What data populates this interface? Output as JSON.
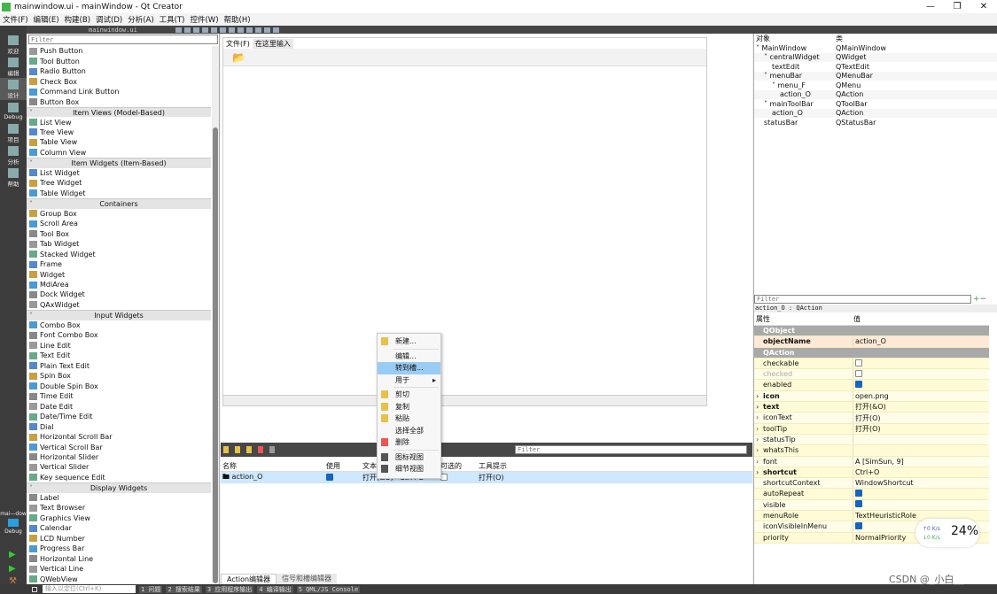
{
  "window": {
    "title": "mainwindow.ui - mainWindow - Qt Creator",
    "controls": [
      "—",
      "❐",
      "✕"
    ]
  },
  "menubar": [
    "文件(F)",
    "编辑(E)",
    "构建(B)",
    "调试(D)",
    "分析(A)",
    "工具(T)",
    "控件(W)",
    "帮助(H)"
  ],
  "editor_tab": "mainwindow.ui",
  "modes": [
    "欢迎",
    "编辑",
    "设计",
    "Debug",
    "项目",
    "分析",
    "帮助"
  ],
  "kit": {
    "name": "mai—dow",
    "mode": "Debug"
  },
  "widgetbox": {
    "filter_placeholder": "Filter",
    "sections": [
      {
        "title": "",
        "items": [
          "Push Button",
          "Tool Button",
          "Radio Button",
          "Check Box",
          "Command Link Button",
          "Button Box"
        ]
      },
      {
        "title": "Item Views (Model-Based)",
        "items": [
          "List View",
          "Tree View",
          "Table View",
          "Column View"
        ]
      },
      {
        "title": "Item Widgets (Item-Based)",
        "items": [
          "List Widget",
          "Tree Widget",
          "Table Widget"
        ]
      },
      {
        "title": "Containers",
        "items": [
          "Group Box",
          "Scroll Area",
          "Tool Box",
          "Tab Widget",
          "Stacked Widget",
          "Frame",
          "Widget",
          "MdiArea",
          "Dock Widget",
          "QAxWidget"
        ]
      },
      {
        "title": "Input Widgets",
        "items": [
          "Combo Box",
          "Font Combo Box",
          "Line Edit",
          "Text Edit",
          "Plain Text Edit",
          "Spin Box",
          "Double Spin Box",
          "Time Edit",
          "Date Edit",
          "Date/Time Edit",
          "Dial",
          "Horizontal Scroll Bar",
          "Vertical Scroll Bar",
          "Horizontal Slider",
          "Vertical Slider",
          "Key sequence Edit"
        ]
      },
      {
        "title": "Display Widgets",
        "items": [
          "Label",
          "Text Browser",
          "Graphics View",
          "Calendar",
          "LCD Number",
          "Progress Bar",
          "Horizontal Line",
          "Vertical Line",
          "QWebView"
        ]
      }
    ]
  },
  "form": {
    "menu": "文件(F)",
    "menu_placeholder": "在这里输入"
  },
  "action_editor": {
    "filter_placeholder": "Filter",
    "headers": [
      "名称",
      "使用",
      "文本",
      "快捷键",
      "可选的",
      "工具提示"
    ],
    "rows": [
      {
        "name": "action_O",
        "used": true,
        "text": "打开(&O)",
        "shortcut": "Ctrl+O",
        "checkable": false,
        "tooltip": "打开(O)"
      }
    ],
    "tabs": [
      "Action编辑器",
      "信号和槽编辑器"
    ]
  },
  "context_menu": [
    {
      "label": "新建...",
      "icon": "new-icon"
    },
    {
      "sep": true
    },
    {
      "label": "编辑..."
    },
    {
      "label": "转到槽...",
      "highlighted": true
    },
    {
      "label": "用于",
      "submenu": true
    },
    {
      "sep": true
    },
    {
      "label": "剪切",
      "icon": "cut-icon"
    },
    {
      "label": "复制",
      "icon": "copy-icon"
    },
    {
      "label": "粘贴",
      "icon": "paste-icon"
    },
    {
      "label": "选择全部"
    },
    {
      "label": "删除",
      "icon": "delete-icon"
    },
    {
      "sep": true
    },
    {
      "label": "图标视图",
      "icon": "icon-view-icon"
    },
    {
      "label": "细节视图",
      "icon": "detail-view-icon"
    }
  ],
  "object_inspector": {
    "headers": [
      "对象",
      "类"
    ],
    "rows": [
      {
        "name": "MainWindow",
        "cls": "QMainWindow",
        "depth": 0,
        "exp": true
      },
      {
        "name": "centralWidget",
        "cls": "QWidget",
        "depth": 1,
        "exp": true
      },
      {
        "name": "textEdit",
        "cls": "QTextEdit",
        "depth": 2
      },
      {
        "name": "menuBar",
        "cls": "QMenuBar",
        "depth": 1,
        "exp": true
      },
      {
        "name": "menu_F",
        "cls": "QMenu",
        "depth": 2,
        "exp": true
      },
      {
        "name": "action_O",
        "cls": "QAction",
        "depth": 3
      },
      {
        "name": "mainToolBar",
        "cls": "QToolBar",
        "depth": 1,
        "exp": true
      },
      {
        "name": "action_O",
        "cls": "QAction",
        "depth": 2
      },
      {
        "name": "statusBar",
        "cls": "QStatusBar",
        "depth": 1
      }
    ]
  },
  "property_editor": {
    "filter_placeholder": "Filter",
    "title": "action_O : QAction",
    "headers": [
      "属性",
      "值"
    ],
    "rows": [
      {
        "name": "QObject",
        "group": true
      },
      {
        "name": "objectName",
        "value": "action_O",
        "bold": true,
        "obj": true
      },
      {
        "name": "QAction",
        "group": true
      },
      {
        "name": "checkable",
        "check": false
      },
      {
        "name": "checked",
        "check": false,
        "disabled": true
      },
      {
        "name": "enabled",
        "check": true
      },
      {
        "name": "icon",
        "value": "open.png",
        "bold": true,
        "exp": true
      },
      {
        "name": "text",
        "value": "打开(&O)",
        "bold": true,
        "exp": true
      },
      {
        "name": "iconText",
        "value": "打开(O)",
        "exp": true
      },
      {
        "name": "toolTip",
        "value": "打开(O)",
        "exp": true
      },
      {
        "name": "statusTip",
        "value": "",
        "exp": true
      },
      {
        "name": "whatsThis",
        "value": "",
        "exp": true
      },
      {
        "name": "font",
        "value": "A  [SimSun, 9]",
        "exp": true
      },
      {
        "name": "shortcut",
        "value": "Ctrl+O",
        "bold": true,
        "exp": true
      },
      {
        "name": "shortcutContext",
        "value": "WindowShortcut"
      },
      {
        "name": "autoRepeat",
        "check": true
      },
      {
        "name": "visible",
        "check": true
      },
      {
        "name": "menuRole",
        "value": "TextHeuristicRole"
      },
      {
        "name": "iconVisibleInMenu",
        "check": true
      },
      {
        "name": "priority",
        "value": "NormalPriority"
      }
    ]
  },
  "statusbar": {
    "locator_placeholder": "输入以定位(Ctrl+K)",
    "panes": [
      "1 问题",
      "2 搜索结果",
      "3 应用程序输出",
      "4 编译输出",
      "5 QML/JS Console"
    ]
  },
  "net_widget": {
    "up": "↑0  K/s",
    "down": "↓0  K/s",
    "cpu": "24%"
  },
  "watermark": "CSDN @_小白__"
}
